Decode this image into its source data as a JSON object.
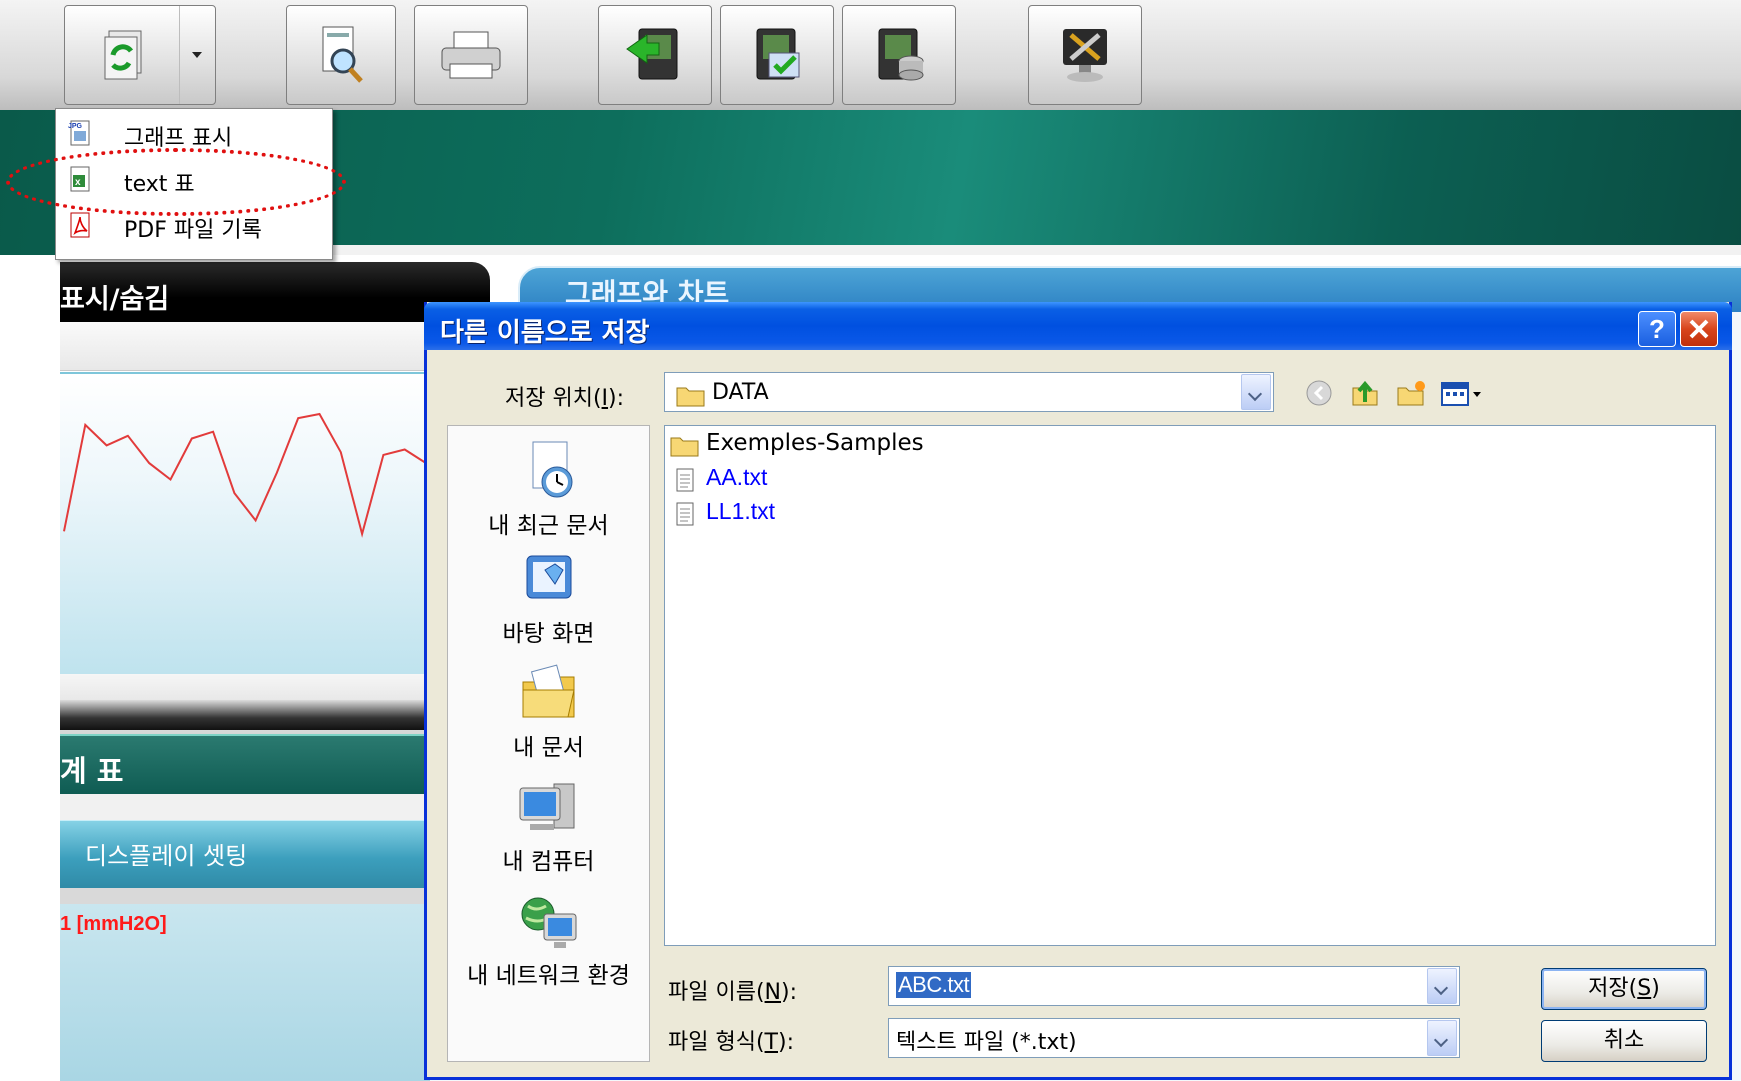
{
  "toolbar": {
    "buttons": [
      {
        "name": "refresh-export-button",
        "icon": "refresh-icon"
      },
      {
        "name": "preview-button",
        "icon": "magnifier-document-icon"
      },
      {
        "name": "print-button",
        "icon": "printer-icon"
      },
      {
        "name": "import-device-button",
        "icon": "device-import-icon"
      },
      {
        "name": "device-check-button",
        "icon": "device-check-icon"
      },
      {
        "name": "device-database-button",
        "icon": "device-database-icon"
      },
      {
        "name": "settings-tools-button",
        "icon": "tools-icon"
      }
    ]
  },
  "popup_menu": {
    "items": [
      {
        "label": "그래프 표시",
        "icon": "jpg-file-icon"
      },
      {
        "label": "text 표",
        "icon": "excel-file-icon"
      },
      {
        "label": "PDF 파일 기록",
        "icon": "pdf-file-icon"
      }
    ]
  },
  "background": {
    "showhide_title": "표시/숨김",
    "graph_tab": "그래프와 차트",
    "stats_title": "계 표",
    "display_setting": "디스플레이 셋팅",
    "unit_label": "1  [mmH2O]"
  },
  "chart_data": {
    "type": "line",
    "title": "",
    "xlabel": "",
    "ylabel": "",
    "series": [
      {
        "values": [
          2,
          80,
          65,
          72,
          52,
          40,
          70,
          75,
          30,
          10,
          45,
          85,
          88,
          60,
          0,
          58,
          62,
          52
        ]
      }
    ]
  },
  "dialog": {
    "title": "다른 이름으로 저장",
    "help": "?",
    "save_in_label": "저장 위치(",
    "save_in_key": "I",
    "save_in_suffix": "):",
    "save_in_value": "DATA",
    "places": [
      {
        "label": "내 최근 문서",
        "icon": "recent-documents-icon"
      },
      {
        "label": "바탕 화면",
        "icon": "desktop-icon"
      },
      {
        "label": "내 문서",
        "icon": "my-documents-icon"
      },
      {
        "label": "내 컴퓨터",
        "icon": "my-computer-icon"
      },
      {
        "label": "내 네트워크 환경",
        "icon": "network-icon"
      }
    ],
    "files": [
      {
        "name": "Exemples-Samples",
        "type": "folder"
      },
      {
        "name": "AA.txt",
        "type": "text"
      },
      {
        "name": "LL1.txt",
        "type": "text"
      }
    ],
    "file_name_label": "파일 이름(",
    "file_name_key": "N",
    "file_name_suffix": "):",
    "file_name_value": "ABC.txt",
    "file_type_label": "파일 형식(",
    "file_type_key": "T",
    "file_type_suffix": "):",
    "file_type_value": "텍스트 파일 (*.txt)",
    "save_button": "저장(",
    "save_key": "S",
    "save_suffix": ")",
    "cancel_button": "취소"
  }
}
